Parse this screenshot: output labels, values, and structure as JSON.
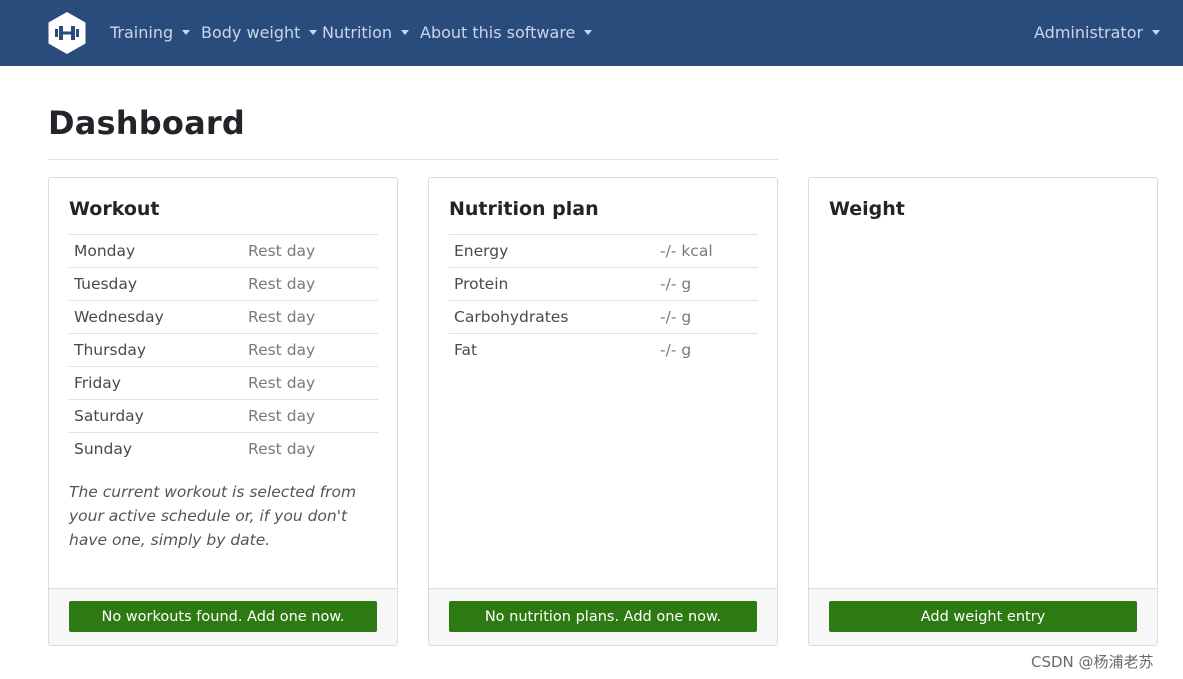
{
  "nav": {
    "items": [
      {
        "label": "Training"
      },
      {
        "label": "Body weight"
      },
      {
        "label": "Nutrition"
      },
      {
        "label": "About this software"
      }
    ],
    "user": "Administrator",
    "logo_icon": "dumbbell-icon",
    "bg_color": "#2a4c7d"
  },
  "page": {
    "title": "Dashboard"
  },
  "workout": {
    "title": "Workout",
    "rows": [
      {
        "day": "Monday",
        "value": "Rest day"
      },
      {
        "day": "Tuesday",
        "value": "Rest day"
      },
      {
        "day": "Wednesday",
        "value": "Rest day"
      },
      {
        "day": "Thursday",
        "value": "Rest day"
      },
      {
        "day": "Friday",
        "value": "Rest day"
      },
      {
        "day": "Saturday",
        "value": "Rest day"
      },
      {
        "day": "Sunday",
        "value": "Rest day"
      }
    ],
    "note": "The current workout is selected from your active schedule or, if you don't have one, simply by date.",
    "button": "No workouts found. Add one now."
  },
  "nutrition": {
    "title": "Nutrition plan",
    "rows": [
      {
        "name": "Energy",
        "value": "-/- kcal"
      },
      {
        "name": "Protein",
        "value": "-/- g"
      },
      {
        "name": "Carbohydrates",
        "value": "-/- g"
      },
      {
        "name": "Fat",
        "value": "-/- g"
      }
    ],
    "button": "No nutrition plans. Add one now."
  },
  "weight": {
    "title": "Weight",
    "button": "Add weight entry"
  },
  "watermark": "CSDN @杨浦老苏",
  "colors": {
    "button_green": "#2e7a12",
    "navbar": "#2a4c7d"
  }
}
